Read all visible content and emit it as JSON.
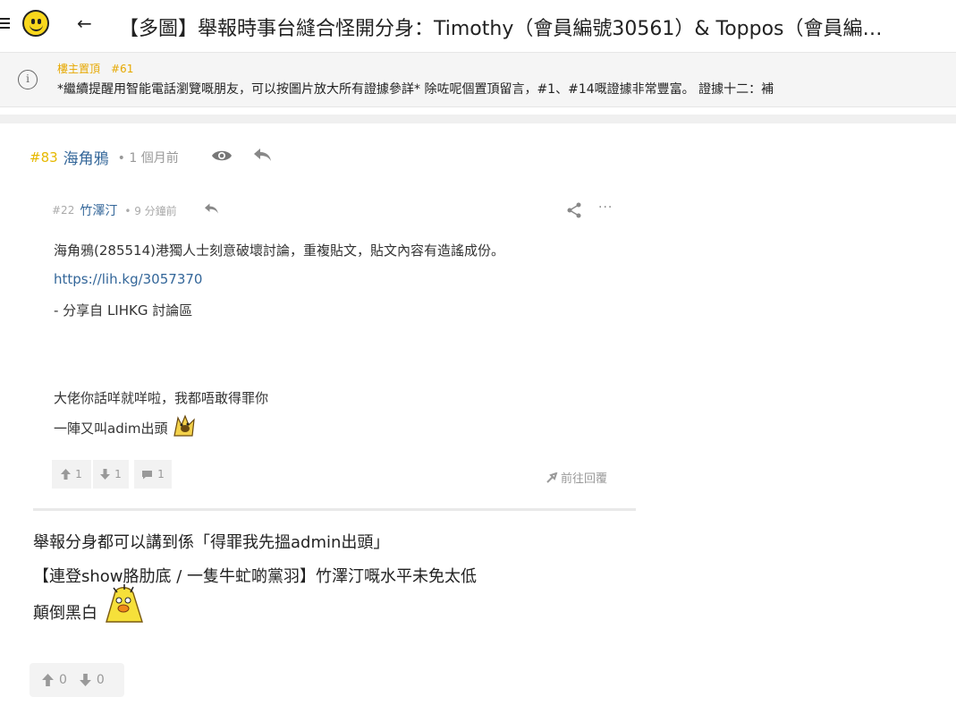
{
  "header": {
    "back_label": "←",
    "title": "【多圖】舉報時事台縫合怪開分身：Timothy（會員編號30561）& Toppos（會員編…"
  },
  "pinned": {
    "label": "樓主置頂　#61",
    "text": "*繼續提醒用智能電話瀏覽嘅朋友，可以按圖片放大所有證據參詳* 除咗呢個置頂留言，#1、#14嘅證據非常豐富。 證據十二：補"
  },
  "post": {
    "number": "#83",
    "author": "海角鴉",
    "time": "• 1 個月前",
    "quote": {
      "number": "#22",
      "author": "竹澤汀",
      "time": "• 9 分鐘前",
      "more": "···",
      "lines": {
        "l1": "海角鴉(285514)港獨人士刻意破壞討論，重複貼文，貼文內容有造謠成份。",
        "link": "https://lih.kg/3057370",
        "l3": "- 分享自 LIHKG 討論區",
        "l4": "大佬你話咩就咩啦，我都唔敢得罪你",
        "l5": "一陣又叫adim出頭"
      },
      "upvotes": "1",
      "downvotes": "1",
      "replies": "1",
      "goto_reply": "前往回覆"
    },
    "body": {
      "l1": "舉報分身都可以講到係「得罪我先搵admin出頭」",
      "l2": "【連登show胳肋底 / 一隻牛虻啲黨羽】竹澤汀嘅水平未免太低",
      "l3": "顛倒黑白"
    },
    "upvotes": "0",
    "downvotes": "0"
  },
  "colors": {
    "accent_yellow": "#e6b800",
    "link_blue": "#336699",
    "muted": "#999999"
  },
  "icons": [
    "menu-icon",
    "smiley-logo-icon",
    "back-arrow-icon",
    "info-icon",
    "eye-icon",
    "reply-icon",
    "share-icon",
    "more-icon",
    "thumb-up-icon",
    "thumb-down-icon",
    "comment-icon",
    "goto-reply-icon",
    "emoji-sticker"
  ]
}
